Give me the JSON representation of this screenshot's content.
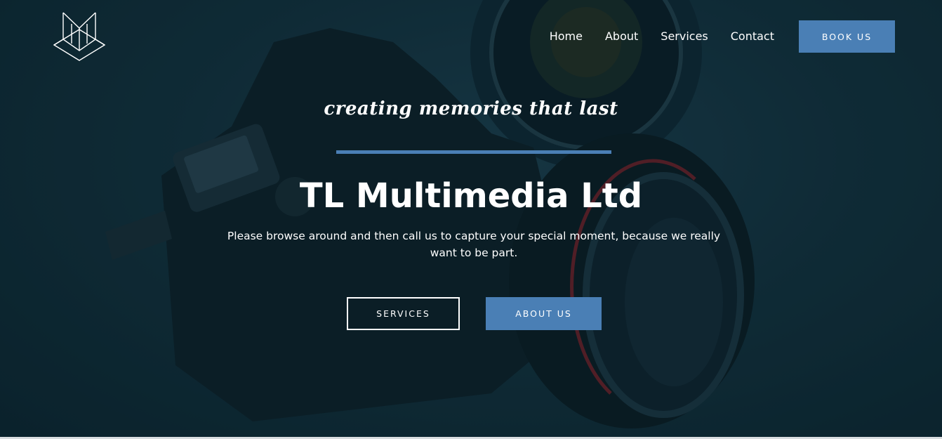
{
  "header": {
    "logo_icon": "geometric-fox-logo",
    "nav": [
      {
        "label": "Home"
      },
      {
        "label": "About"
      },
      {
        "label": "Services"
      },
      {
        "label": "Contact"
      }
    ],
    "cta_label": "BOOK US"
  },
  "hero": {
    "tagline": "creating memories that last",
    "title": "TL Multimedia Ltd",
    "subtitle": "Please browse around and then call us to capture your special moment, because we really want to be part.",
    "buttons": {
      "services_label": "SERVICES",
      "about_label": "ABOUT US"
    },
    "background_image": "camera-photo"
  },
  "colors": {
    "accent": "#4a7fb5",
    "background": "#13303b",
    "text": "#ffffff"
  }
}
